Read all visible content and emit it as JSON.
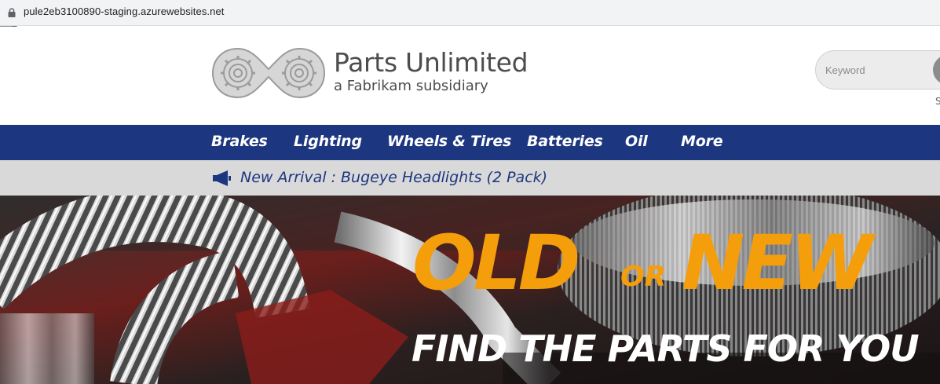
{
  "browser": {
    "url": "pule2eb3100890-staging.azurewebsites.net"
  },
  "header": {
    "brand_title": "Parts Unlimited",
    "brand_subtitle": "a Fabrikam subsidiary",
    "search_placeholder": "Keyword",
    "under_search_fragment": "S"
  },
  "nav": {
    "items": [
      "Brakes",
      "Lighting",
      "Wheels & Tires",
      "Batteries",
      "Oil",
      "More"
    ]
  },
  "announcement": {
    "text": "New Arrival : Bugeye Headlights (2 Pack)"
  },
  "hero": {
    "word_old": "OLD",
    "word_or": "OR",
    "word_new": "NEW",
    "subtitle": "FIND THE PARTS FOR YOU"
  },
  "colors": {
    "nav_bg": "#1c3680",
    "announce_bg": "#d9d9d9",
    "hero_accent": "#f59e0b"
  },
  "icons": [
    "lock-icon",
    "logo-gears-icon",
    "search-icon",
    "megaphone-icon"
  ]
}
